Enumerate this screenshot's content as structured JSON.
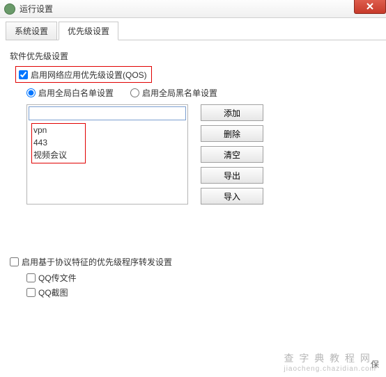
{
  "window": {
    "title": "运行设置"
  },
  "tabs": {
    "system": "系统设置",
    "priority": "优先级设置"
  },
  "section1": {
    "title": "软件优先级设置",
    "enable_qos": "启用网络应用优先级设置(QOS)",
    "radio_white": "启用全局白名单设置",
    "radio_black": "启用全局黑名单设置",
    "items": {
      "i0": "vpn",
      "i1": "443",
      "i2": "视频会议"
    },
    "buttons": {
      "add": "添加",
      "del": "删除",
      "clear": "清空",
      "export": "导出",
      "import": "导入"
    }
  },
  "section2": {
    "title": "启用基于协议特征的优先级程序转发设置",
    "qq_file": "QQ传文件",
    "qq_shot": "QQ截图"
  },
  "footer": {
    "save_hint": "保"
  },
  "watermark": {
    "line1": "查 字 典 教 程 网",
    "line2": "jiaocheng.chazidian.com"
  }
}
